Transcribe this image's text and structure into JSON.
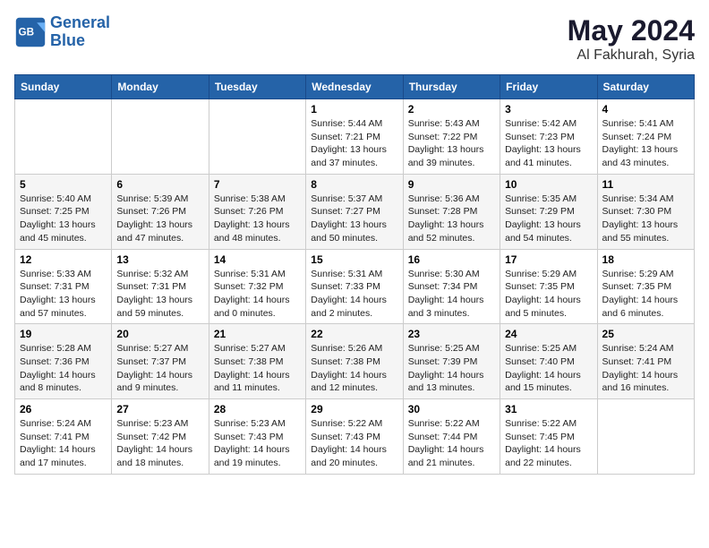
{
  "header": {
    "logo_line1": "General",
    "logo_line2": "Blue",
    "title": "May 2024",
    "location": "Al Fakhurah, Syria"
  },
  "days_of_week": [
    "Sunday",
    "Monday",
    "Tuesday",
    "Wednesday",
    "Thursday",
    "Friday",
    "Saturday"
  ],
  "weeks": [
    [
      {
        "day": "",
        "info": ""
      },
      {
        "day": "",
        "info": ""
      },
      {
        "day": "",
        "info": ""
      },
      {
        "day": "1",
        "info": "Sunrise: 5:44 AM\nSunset: 7:21 PM\nDaylight: 13 hours\nand 37 minutes."
      },
      {
        "day": "2",
        "info": "Sunrise: 5:43 AM\nSunset: 7:22 PM\nDaylight: 13 hours\nand 39 minutes."
      },
      {
        "day": "3",
        "info": "Sunrise: 5:42 AM\nSunset: 7:23 PM\nDaylight: 13 hours\nand 41 minutes."
      },
      {
        "day": "4",
        "info": "Sunrise: 5:41 AM\nSunset: 7:24 PM\nDaylight: 13 hours\nand 43 minutes."
      }
    ],
    [
      {
        "day": "5",
        "info": "Sunrise: 5:40 AM\nSunset: 7:25 PM\nDaylight: 13 hours\nand 45 minutes."
      },
      {
        "day": "6",
        "info": "Sunrise: 5:39 AM\nSunset: 7:26 PM\nDaylight: 13 hours\nand 47 minutes."
      },
      {
        "day": "7",
        "info": "Sunrise: 5:38 AM\nSunset: 7:26 PM\nDaylight: 13 hours\nand 48 minutes."
      },
      {
        "day": "8",
        "info": "Sunrise: 5:37 AM\nSunset: 7:27 PM\nDaylight: 13 hours\nand 50 minutes."
      },
      {
        "day": "9",
        "info": "Sunrise: 5:36 AM\nSunset: 7:28 PM\nDaylight: 13 hours\nand 52 minutes."
      },
      {
        "day": "10",
        "info": "Sunrise: 5:35 AM\nSunset: 7:29 PM\nDaylight: 13 hours\nand 54 minutes."
      },
      {
        "day": "11",
        "info": "Sunrise: 5:34 AM\nSunset: 7:30 PM\nDaylight: 13 hours\nand 55 minutes."
      }
    ],
    [
      {
        "day": "12",
        "info": "Sunrise: 5:33 AM\nSunset: 7:31 PM\nDaylight: 13 hours\nand 57 minutes."
      },
      {
        "day": "13",
        "info": "Sunrise: 5:32 AM\nSunset: 7:31 PM\nDaylight: 13 hours\nand 59 minutes."
      },
      {
        "day": "14",
        "info": "Sunrise: 5:31 AM\nSunset: 7:32 PM\nDaylight: 14 hours\nand 0 minutes."
      },
      {
        "day": "15",
        "info": "Sunrise: 5:31 AM\nSunset: 7:33 PM\nDaylight: 14 hours\nand 2 minutes."
      },
      {
        "day": "16",
        "info": "Sunrise: 5:30 AM\nSunset: 7:34 PM\nDaylight: 14 hours\nand 3 minutes."
      },
      {
        "day": "17",
        "info": "Sunrise: 5:29 AM\nSunset: 7:35 PM\nDaylight: 14 hours\nand 5 minutes."
      },
      {
        "day": "18",
        "info": "Sunrise: 5:29 AM\nSunset: 7:35 PM\nDaylight: 14 hours\nand 6 minutes."
      }
    ],
    [
      {
        "day": "19",
        "info": "Sunrise: 5:28 AM\nSunset: 7:36 PM\nDaylight: 14 hours\nand 8 minutes."
      },
      {
        "day": "20",
        "info": "Sunrise: 5:27 AM\nSunset: 7:37 PM\nDaylight: 14 hours\nand 9 minutes."
      },
      {
        "day": "21",
        "info": "Sunrise: 5:27 AM\nSunset: 7:38 PM\nDaylight: 14 hours\nand 11 minutes."
      },
      {
        "day": "22",
        "info": "Sunrise: 5:26 AM\nSunset: 7:38 PM\nDaylight: 14 hours\nand 12 minutes."
      },
      {
        "day": "23",
        "info": "Sunrise: 5:25 AM\nSunset: 7:39 PM\nDaylight: 14 hours\nand 13 minutes."
      },
      {
        "day": "24",
        "info": "Sunrise: 5:25 AM\nSunset: 7:40 PM\nDaylight: 14 hours\nand 15 minutes."
      },
      {
        "day": "25",
        "info": "Sunrise: 5:24 AM\nSunset: 7:41 PM\nDaylight: 14 hours\nand 16 minutes."
      }
    ],
    [
      {
        "day": "26",
        "info": "Sunrise: 5:24 AM\nSunset: 7:41 PM\nDaylight: 14 hours\nand 17 minutes."
      },
      {
        "day": "27",
        "info": "Sunrise: 5:23 AM\nSunset: 7:42 PM\nDaylight: 14 hours\nand 18 minutes."
      },
      {
        "day": "28",
        "info": "Sunrise: 5:23 AM\nSunset: 7:43 PM\nDaylight: 14 hours\nand 19 minutes."
      },
      {
        "day": "29",
        "info": "Sunrise: 5:22 AM\nSunset: 7:43 PM\nDaylight: 14 hours\nand 20 minutes."
      },
      {
        "day": "30",
        "info": "Sunrise: 5:22 AM\nSunset: 7:44 PM\nDaylight: 14 hours\nand 21 minutes."
      },
      {
        "day": "31",
        "info": "Sunrise: 5:22 AM\nSunset: 7:45 PM\nDaylight: 14 hours\nand 22 minutes."
      },
      {
        "day": "",
        "info": ""
      }
    ]
  ]
}
